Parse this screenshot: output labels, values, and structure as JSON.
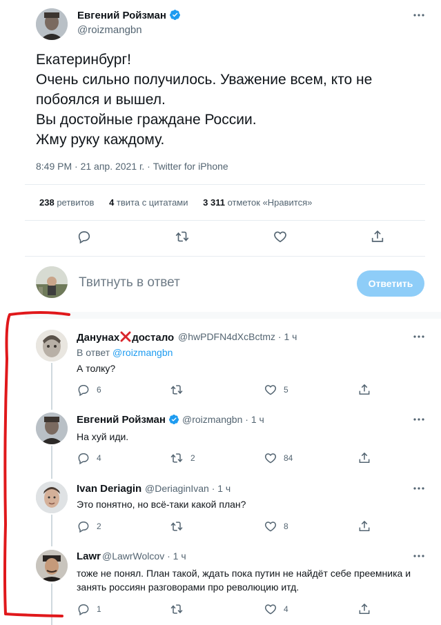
{
  "main_tweet": {
    "author_name": "Евгений Ройзман",
    "author_handle": "@roizmangbn",
    "text": "Екатеринбург!\nОчень сильно  получилось. Уважение всем, кто не побоялся и вышел.\nВы достойные граждане России.\nЖму руку каждому.",
    "meta": "8:49 PM · 21 апр. 2021 г. · Twitter for iPhone",
    "stats": [
      {
        "count": "238",
        "label": "ретвитов"
      },
      {
        "count": "4",
        "label": "твита с цитатами"
      },
      {
        "count": "3 311",
        "label": "отметок «Нравится»"
      }
    ]
  },
  "reply_box": {
    "placeholder": "Твитнуть в ответ",
    "button_label": "Ответить"
  },
  "replies": [
    {
      "name_part1": "Данунах",
      "name_part2": "достало",
      "handle": "@hwPDFN4dXcBctmz",
      "time": "· 1 ч",
      "reply_to_prefix": "В ответ",
      "reply_to_handle": "@roizmangbn",
      "text": "А толку?",
      "replies": "6",
      "retweets": "",
      "likes": "5"
    },
    {
      "name": "Евгений Ройзман",
      "handle": "@roizmangbn",
      "time": "· 1 ч",
      "text": "На хуй иди.",
      "replies": "4",
      "retweets": "2",
      "likes": "84"
    },
    {
      "name": "Ivan Deriagin",
      "handle": "@DeriaginIvan",
      "time": "· 1 ч",
      "text": "Это понятно, но всё-таки какой план?",
      "replies": "2",
      "retweets": "",
      "likes": "8"
    },
    {
      "name": "Lawr",
      "handle": "@LawrWolcov",
      "time": "· 1 ч",
      "text": "тоже не понял. План такой, ждать пока путин не найдёт себе преемника и занять россиян разговорами про революцию итд.",
      "replies": "1",
      "retweets": "",
      "likes": "4"
    }
  ],
  "colors": {
    "accent": "#1d9bf0",
    "reply_button": "#8ecdf8",
    "secondary_text": "#536471",
    "red_annotation": "#e0181b"
  }
}
